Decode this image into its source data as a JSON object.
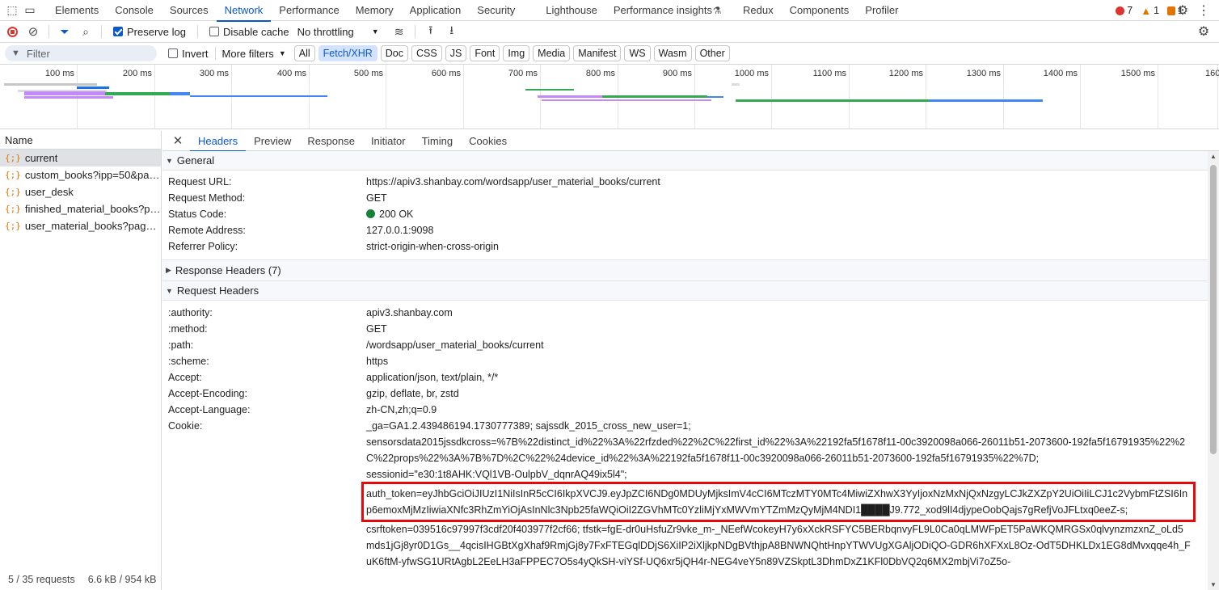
{
  "top_tabs": [
    "Elements",
    "Console",
    "Sources",
    "Network",
    "Performance",
    "Memory",
    "Application",
    "Security",
    "Lighthouse",
    "Performance insights",
    "Redux",
    "Components",
    "Profiler"
  ],
  "counts": {
    "errors": "7",
    "warnings": "1",
    "issues": "1"
  },
  "toolbar": {
    "preserve_log": "Preserve log",
    "disable_cache": "Disable cache",
    "throttling": "No throttling"
  },
  "filter": {
    "placeholder": "Filter",
    "invert": "Invert",
    "more_filters": "More filters",
    "chips": [
      "All",
      "Fetch/XHR",
      "Doc",
      "CSS",
      "JS",
      "Font",
      "Img",
      "Media",
      "Manifest",
      "WS",
      "Wasm",
      "Other"
    ]
  },
  "timeline_ticks": [
    "100 ms",
    "200 ms",
    "300 ms",
    "400 ms",
    "500 ms",
    "600 ms",
    "700 ms",
    "800 ms",
    "900 ms",
    "1000 ms",
    "1100 ms",
    "1200 ms",
    "1300 ms",
    "1400 ms",
    "1500 ms",
    "160"
  ],
  "requests": {
    "header": "Name",
    "items": [
      "current",
      "custom_books?ipp=50&pag...",
      "user_desk",
      "finished_material_books?pa...",
      "user_material_books?page=..."
    ],
    "footer_requests": "5 / 35 requests",
    "footer_size": "6.6 kB / 954 kB"
  },
  "detail_tabs": [
    "Headers",
    "Preview",
    "Response",
    "Initiator",
    "Timing",
    "Cookies"
  ],
  "general": {
    "title": "General",
    "rows": [
      {
        "k": "Request URL:",
        "v": "https://apiv3.shanbay.com/wordsapp/user_material_books/current"
      },
      {
        "k": "Request Method:",
        "v": "GET"
      },
      {
        "k": "Status Code:",
        "v": "200 OK"
      },
      {
        "k": "Remote Address:",
        "v": "127.0.0.1:9098"
      },
      {
        "k": "Referrer Policy:",
        "v": "strict-origin-when-cross-origin"
      }
    ]
  },
  "response_headers_title": "Response Headers (7)",
  "request_headers": {
    "title": "Request Headers",
    "rows": [
      {
        "k": ":authority:",
        "v": "apiv3.shanbay.com"
      },
      {
        "k": ":method:",
        "v": "GET"
      },
      {
        "k": ":path:",
        "v": "/wordsapp/user_material_books/current"
      },
      {
        "k": ":scheme:",
        "v": "https"
      },
      {
        "k": "Accept:",
        "v": "application/json, text/plain, */*"
      },
      {
        "k": "Accept-Encoding:",
        "v": "gzip, deflate, br, zstd"
      },
      {
        "k": "Accept-Language:",
        "v": "zh-CN,zh;q=0.9"
      }
    ],
    "cookie_key": "Cookie:",
    "cookie_lines": [
      "_ga=GA1.2.439486194.1730777389; sajssdk_2015_cross_new_user=1;",
      "sensorsdata2015jssdkcross=%7B%22distinct_id%22%3A%22rfzded%22%2C%22first_id%22%3A%22192fa5f1678f11-00c3920098a066-26011b51-2073600-192fa5f16791935%22%2C%22props%22%3A%7B%7D%2C%22%24device_id%22%3A%22192fa5f1678f11-00c3920098a066-26011b51-2073600-192fa5f16791935%22%7D;",
      "sessionid=\"e30:1t8AHK:VQl1VB-OulpbV_dqnrAQ49ix5l4\";"
    ],
    "auth_token": "auth_token=eyJhbGciOiJIUzI1NiIsInR5cCI6IkpXVCJ9.eyJpZCI6NDg0MDUyMjksImV4cCI6MTczMTY0MTc4MiwiZXhwX3YyIjoxNzMxNjQxNzgyLCJkZXZpY2UiOiIiLCJ1c2VybmFtZSI6Inp6emoxMjMzIiwiaXNfc3RhZmYiOjAsInNlc3Npb25faWQiOiI2ZGVhMTc0YzliMjYxMWVmYTZmMzQyMjM4NDI1████J9.772_xod9lI4djypeOobQajs7gRefjVoJFLtxq0eeZ-s;",
    "cookie_tail": "csrftoken=039516c97997f3cdf20f403977f2cf66; tfstk=fgE-dr0uHsfuZr9vke_m-_NEefWcokeyH7y6xXckRSFYC5BERbqnvyFL9L0Ca0qLMWFpET5PaWKQMRGSx0qlvynzmzxnZ_oLd5mds1jGj8yr0D1Gs__4qcisIHGBtXgXhaf9RmjGj8y7FxFTEGqlDDjS6XiIP2iXljkpNDgBVthjpA8BNWNQhtHnpYTWVUgXGAljODiQO-GDR6hXFXxL8Oz-OdT5DHKLDx1EG8dMvxqqe4h_FuK6ftM-yfwSG1URtAgbL2EeLH3aFPPEC7O5s4yQkSH-viYSf-UQ6xr5jQH4r-NEG4veY5n89VZSkptL3DhmDxZ1KFl0DbVQ2q6MX2mbjVi7oZ5o-"
  }
}
